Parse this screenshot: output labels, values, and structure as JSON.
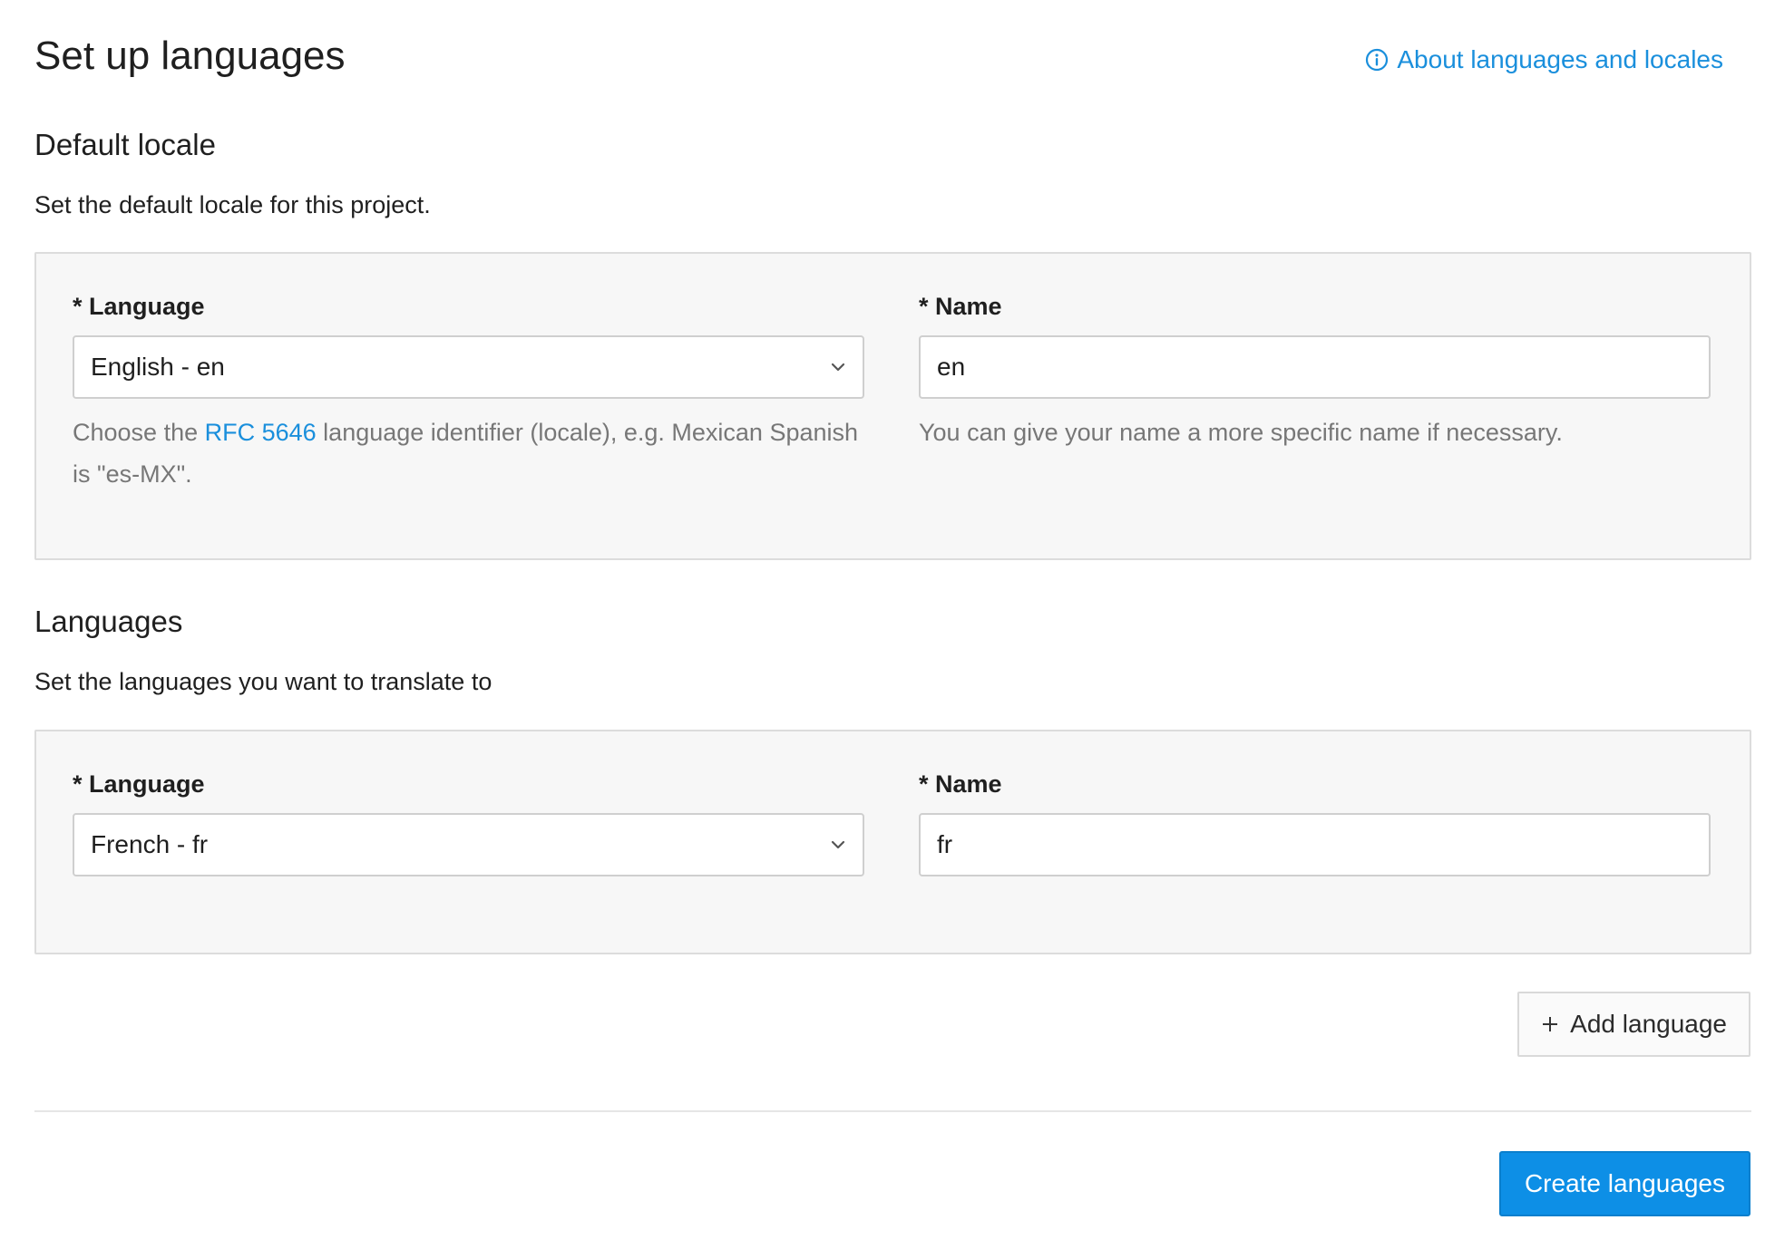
{
  "header": {
    "title": "Set up languages",
    "help_link": {
      "label": "About languages and locales",
      "icon": "info-circle-icon"
    }
  },
  "default_locale": {
    "heading": "Default locale",
    "description": "Set the default locale for this project.",
    "language_label": "* Language",
    "language_value": "English - en",
    "language_help_prefix": "Choose the ",
    "language_help_link": "RFC 5646",
    "language_help_suffix": " language identifier (locale), e.g. Mexican Spanish is \"es-MX\".",
    "name_label": "* Name",
    "name_value": "en",
    "name_help": "You can give your name a more specific name if necessary."
  },
  "languages": {
    "heading": "Languages",
    "description": "Set the languages you want to translate to",
    "items": [
      {
        "language_label": "* Language",
        "language_value": "French - fr",
        "name_label": "* Name",
        "name_value": "fr"
      }
    ]
  },
  "actions": {
    "add_language": {
      "label": "Add language",
      "icon": "plus-icon"
    },
    "create": {
      "label": "Create languages"
    }
  },
  "colors": {
    "accent": "#1a8fdc",
    "primary_button": "#0d8fe6",
    "panel_bg": "#f7f7f7",
    "helper_text": "#777777"
  }
}
